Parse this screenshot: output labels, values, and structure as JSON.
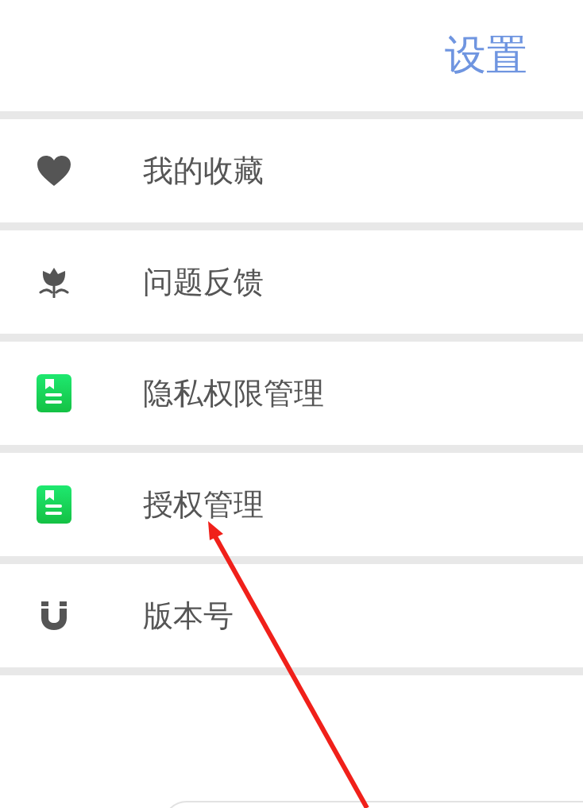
{
  "header": {
    "title": "设置"
  },
  "menu_items": [
    {
      "kind": "heart",
      "label": "我的收藏"
    },
    {
      "kind": "tulip",
      "label": "问题反馈"
    },
    {
      "kind": "book",
      "label": "隐私权限管理"
    },
    {
      "kind": "book",
      "label": "授权管理"
    },
    {
      "kind": "magnet",
      "label": "版本号"
    }
  ]
}
